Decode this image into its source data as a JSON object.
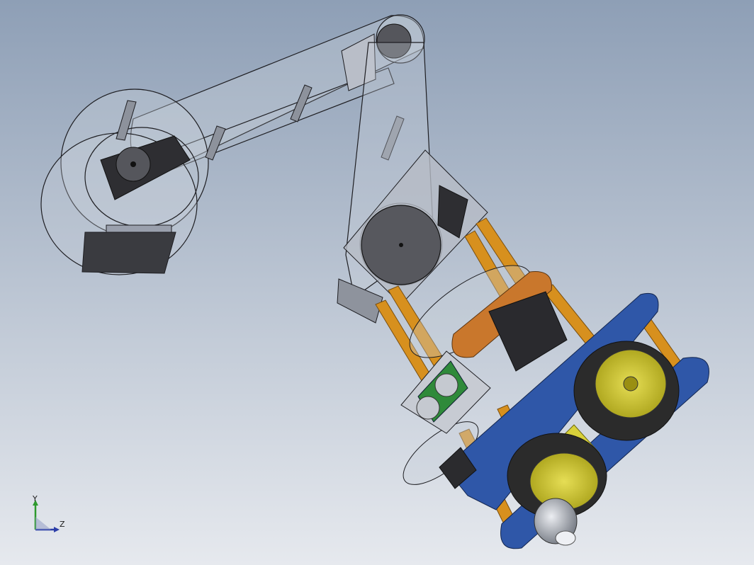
{
  "viewport": {
    "background_top": "#8e9fb6",
    "background_bottom": "#e6e9ee"
  },
  "model": {
    "colors": {
      "transparent_part": "#c9d0da",
      "outline": "#1e1e22",
      "servo_dark": "#2e2e32",
      "bracket_gray": "#9aa0ad",
      "standoff_orange": "#d7901e",
      "plate_blue": "#2f57a8",
      "plate_orange": "#c9772c",
      "wheel_yellow": "#d8d13a",
      "tire_dark": "#2b2b2b",
      "sensor_green": "#2f8a3a",
      "caster_silver": "#b7bcc4"
    }
  },
  "triad": {
    "y_label": "Y",
    "z_label": "Z",
    "y_color": "#2d9a2d",
    "z_color": "#2c3ea8"
  }
}
